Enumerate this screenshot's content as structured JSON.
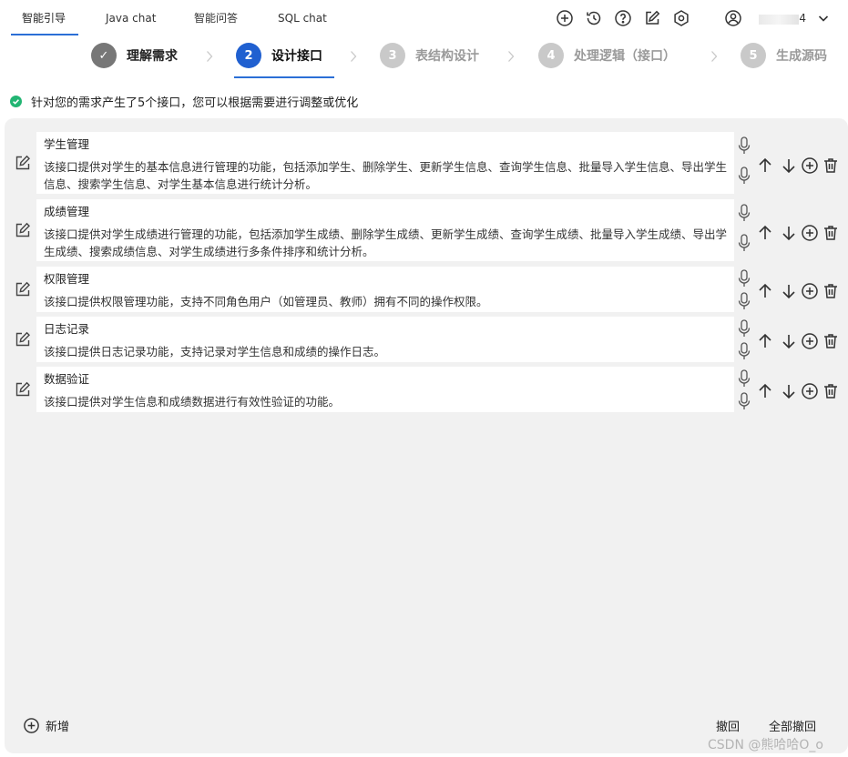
{
  "tabs": [
    {
      "label": "智能引导",
      "active": true
    },
    {
      "label": "Java chat",
      "active": false
    },
    {
      "label": "智能问答",
      "active": false
    },
    {
      "label": "SQL chat",
      "active": false
    }
  ],
  "header_icons": [
    "add-circle-icon",
    "history-icon",
    "help-icon",
    "edit-icon",
    "settings-icon"
  ],
  "user": {
    "name": "4",
    "icon": "user-icon",
    "menu_icon": "chevron-down-icon"
  },
  "stepper": {
    "steps": [
      {
        "number": "✓",
        "label": "理解需求",
        "state": "done"
      },
      {
        "number": "2",
        "label": "设计接口",
        "state": "current"
      },
      {
        "number": "3",
        "label": "表结构设计",
        "state": "todo"
      },
      {
        "number": "4",
        "label": "处理逻辑（接口）",
        "state": "todo"
      },
      {
        "number": "5",
        "label": "生成源码",
        "state": "todo"
      }
    ]
  },
  "notice": {
    "text": "针对您的需求产生了5个接口，您可以根据需要进行调整或优化",
    "icon": "check-circle-icon",
    "color": "#22b573"
  },
  "interfaces": [
    {
      "title": "学生管理",
      "description": "该接口提供对学生的基本信息进行管理的功能，包括添加学生、删除学生、更新学生信息、查询学生信息、批量导入学生信息、导出学生信息、搜索学生信息、对学生基本信息进行统计分析。"
    },
    {
      "title": "成绩管理",
      "description": "该接口提供对学生成绩进行管理的功能，包括添加学生成绩、删除学生成绩、更新学生成绩、查询学生成绩、批量导入学生成绩、导出学生成绩、搜索成绩信息、对学生成绩进行多条件排序和统计分析。"
    },
    {
      "title": "权限管理",
      "description": "该接口提供权限管理功能，支持不同角色用户（如管理员、教师）拥有不同的操作权限。"
    },
    {
      "title": "日志记录",
      "description": "该接口提供日志记录功能，支持记录对学生信息和成绩的操作日志。"
    },
    {
      "title": "数据验证",
      "description": "该接口提供对学生信息和成绩数据进行有效性验证的功能。"
    }
  ],
  "actions": {
    "add_label": "新增",
    "undo_label": "撤回",
    "undo_all_label": "全部撤回"
  },
  "watermark": "CSDN @熊哈哈O_o",
  "colors": {
    "accent": "#2060d0",
    "done_step": "#777777",
    "todo_step": "#c9c9c9",
    "panel_bg": "#f1f1f1"
  }
}
